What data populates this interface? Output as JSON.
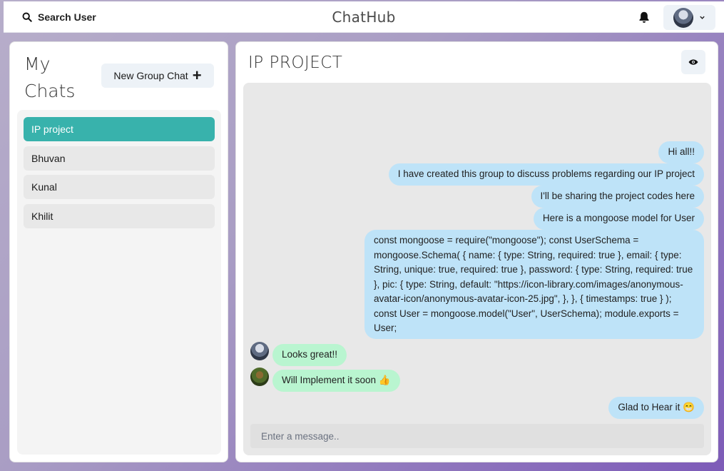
{
  "header": {
    "search_label": "Search User",
    "app_title": "ChatHub",
    "icons": [
      "search-icon",
      "bell-icon",
      "avatar",
      "chevron-down-icon"
    ]
  },
  "sidebar": {
    "title": "My Chats",
    "new_group_label": "New Group Chat",
    "chats": [
      {
        "label": "IP project",
        "active": true
      },
      {
        "label": "Bhuvan",
        "active": false
      },
      {
        "label": "Kunal",
        "active": false
      },
      {
        "label": "Khilit",
        "active": false
      }
    ]
  },
  "chat": {
    "title": "IP PROJECT",
    "messages": [
      {
        "sender": "me",
        "text": "Hi all!!"
      },
      {
        "sender": "me",
        "text": "I have created this group to discuss problems regarding our IP project"
      },
      {
        "sender": "me",
        "text": "I'll be sharing the project codes here"
      },
      {
        "sender": "me",
        "text": "Here is a mongoose model for User"
      },
      {
        "sender": "me",
        "text": "const mongoose = require(\"mongoose\"); const UserSchema = mongoose.Schema( { name: { type: String, required: true }, email: { type: String, unique: true, required: true }, password: { type: String, required: true }, pic: { type: String, default: \"https://icon-library.com/images/anonymous-avatar-icon/anonymous-avatar-icon-25.jpg\", }, }, { timestamps: true } ); const User = mongoose.model(\"User\", UserSchema); module.exports = User;"
      },
      {
        "sender": "other",
        "text": "Looks great!!"
      },
      {
        "sender": "other",
        "text": "Will Implement it soon 👍"
      },
      {
        "sender": "me",
        "text": "Glad to Hear it 😁"
      }
    ],
    "input_placeholder": "Enter a message..",
    "colors": {
      "mine": "#bee3f8",
      "theirs": "#b9f5d0",
      "active_chat": "#38b2ac"
    }
  }
}
